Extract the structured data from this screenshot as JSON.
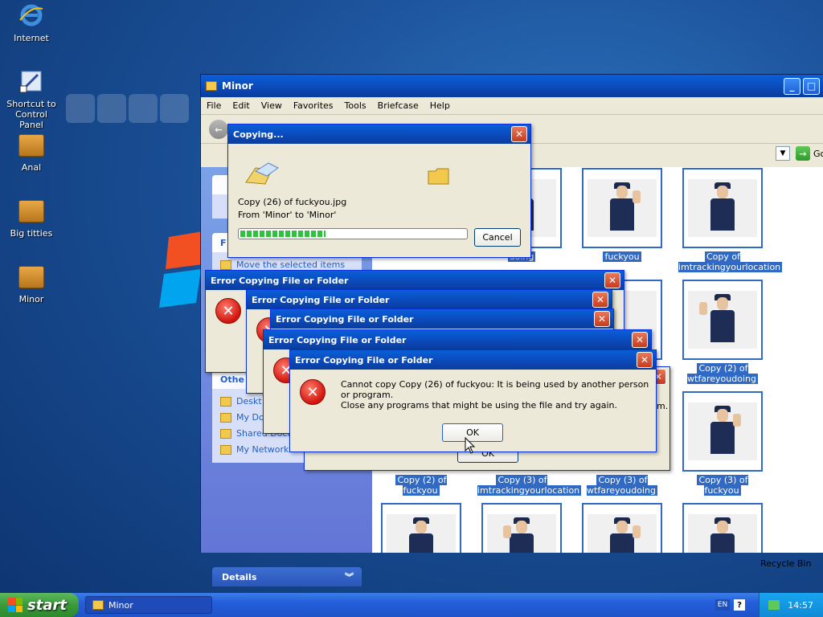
{
  "desktop": {
    "icons": [
      {
        "label": "Internet"
      },
      {
        "label": "Shortcut to Control Panel"
      },
      {
        "label": "Anal"
      },
      {
        "label": "Big titties"
      },
      {
        "label": "Minor"
      }
    ],
    "recycle_bin": "Recycle Bin"
  },
  "explorer": {
    "title": "Minor",
    "menu": [
      "File",
      "Edit",
      "View",
      "Favorites",
      "Tools",
      "Briefcase",
      "Help"
    ],
    "go_label": "Go",
    "pane_partial_headers": [
      "F",
      "Othe"
    ],
    "pane_move_link": "Move the selected items",
    "other_places": [
      "Deskt",
      "My Do",
      "Shared Docu",
      "My Network"
    ],
    "details_header": "Details",
    "files": [
      {
        "caption": "fuckyou"
      },
      {
        "caption": "doing"
      },
      {
        "caption": "Copy of imtrackingyourlocation"
      },
      {
        "caption": "Copy (2) of wtfareyoudoing"
      },
      {
        "caption": "Copy (2) of fuckyou"
      },
      {
        "caption": "Copy (3) of imtrackingyourlocation"
      },
      {
        "caption": "Copy (3) of wtfareyoudoing"
      },
      {
        "caption": "Copy (3) of fuckyou"
      }
    ]
  },
  "copying": {
    "title": "Copying...",
    "file_line": "Copy (26) of fuckyou.jpg",
    "from_line": "From 'Minor' to 'Minor'",
    "cancel": "Cancel",
    "progress_percent": 38
  },
  "errors": {
    "title": "Error Copying File or Folder",
    "message": "Cannot copy Copy (26) of fuckyou: It is being used by another person or program.",
    "hint": "Close any programs that might be using the file and try again.",
    "ok": "OK",
    "behind_ok": "OK",
    "partial_text": "m."
  },
  "taskbar": {
    "start": "start",
    "task": "Minor",
    "lang": "EN",
    "help": "?",
    "clock": "14:57"
  },
  "colors": {
    "xp_blue": "#0a5fd8",
    "selection": "#316ac5",
    "start_green": "#3a9a3a"
  }
}
